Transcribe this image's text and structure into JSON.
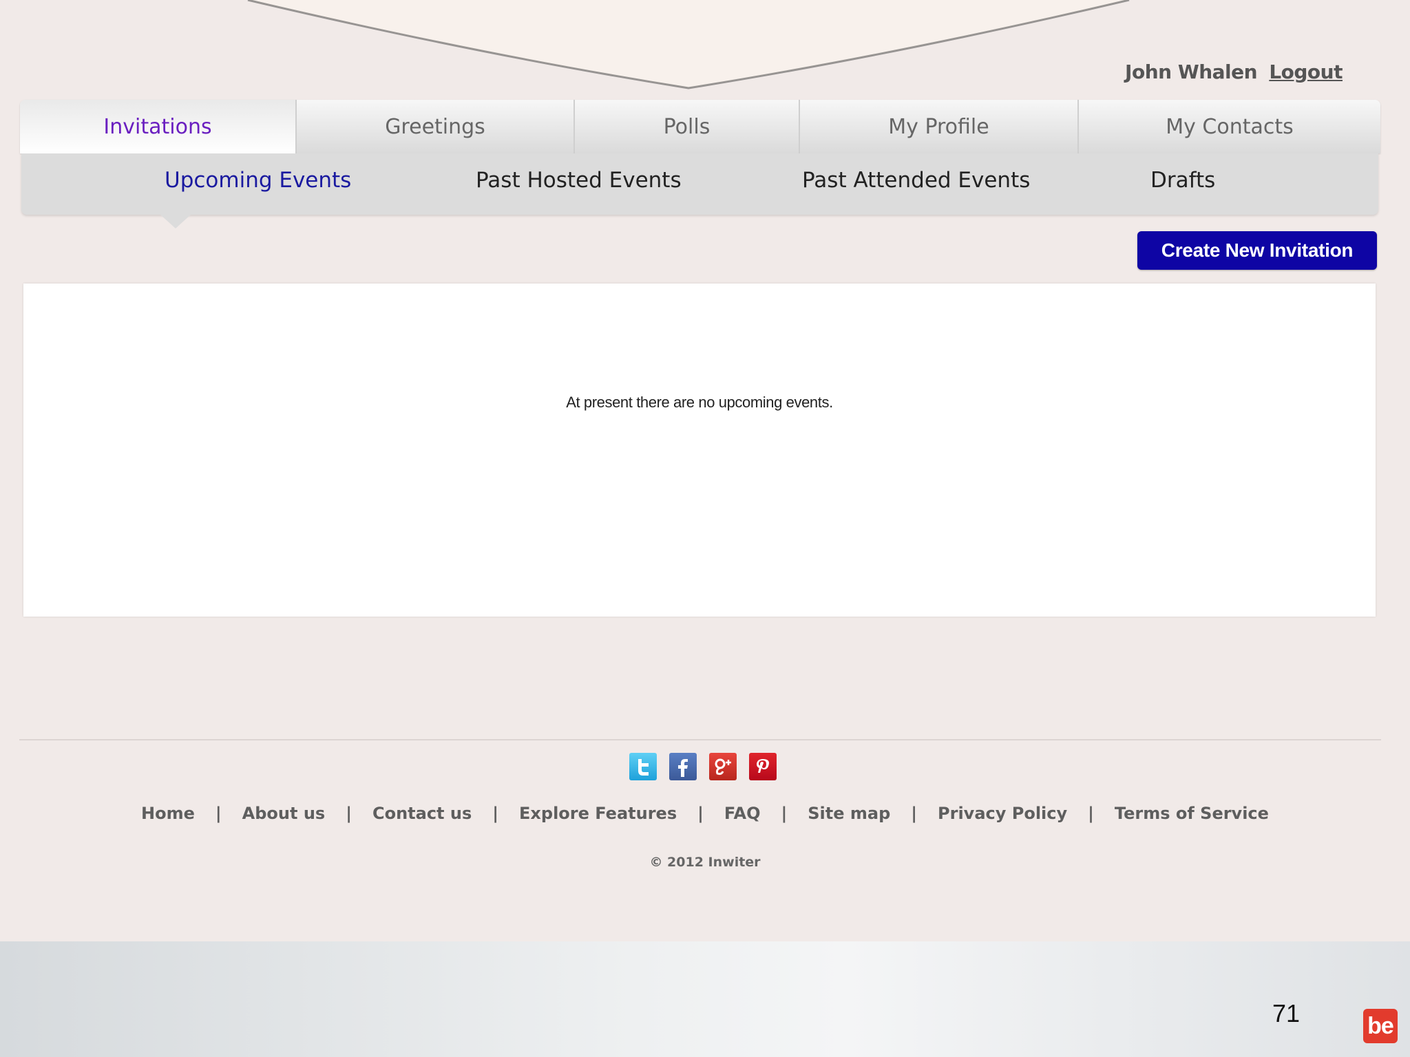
{
  "user": {
    "name": "John Whalen",
    "logout_label": "Logout"
  },
  "main_tabs": [
    {
      "label": "Invitations",
      "active": true
    },
    {
      "label": "Greetings",
      "active": false
    },
    {
      "label": "Polls",
      "active": false
    },
    {
      "label": "My Profile",
      "active": false
    },
    {
      "label": "My Contacts",
      "active": false
    }
  ],
  "sub_tabs": [
    {
      "label": "Upcoming Events",
      "active": true
    },
    {
      "label": "Past Hosted Events",
      "active": false
    },
    {
      "label": "Past Attended Events",
      "active": false
    },
    {
      "label": "Drafts",
      "active": false
    }
  ],
  "actions": {
    "create_label": "Create New Invitation"
  },
  "content": {
    "empty_message": "At present there are no upcoming events."
  },
  "social": [
    "twitter-icon",
    "facebook-icon",
    "google-plus-icon",
    "pinterest-icon"
  ],
  "footer": {
    "links": [
      "Home",
      "About us",
      "Contact us",
      "Explore Features",
      "FAQ",
      "Site map",
      "Privacy Policy",
      "Terms of Service"
    ],
    "separator": "|",
    "copyright": "© 2012 Inwiter"
  },
  "slide": {
    "page_number": "71",
    "logo_text": "be"
  },
  "colors": {
    "active_tab": "#6a1fc0",
    "active_subtab": "#1a1aa0",
    "button": "#0e05a4",
    "background": "#f1eae8"
  }
}
